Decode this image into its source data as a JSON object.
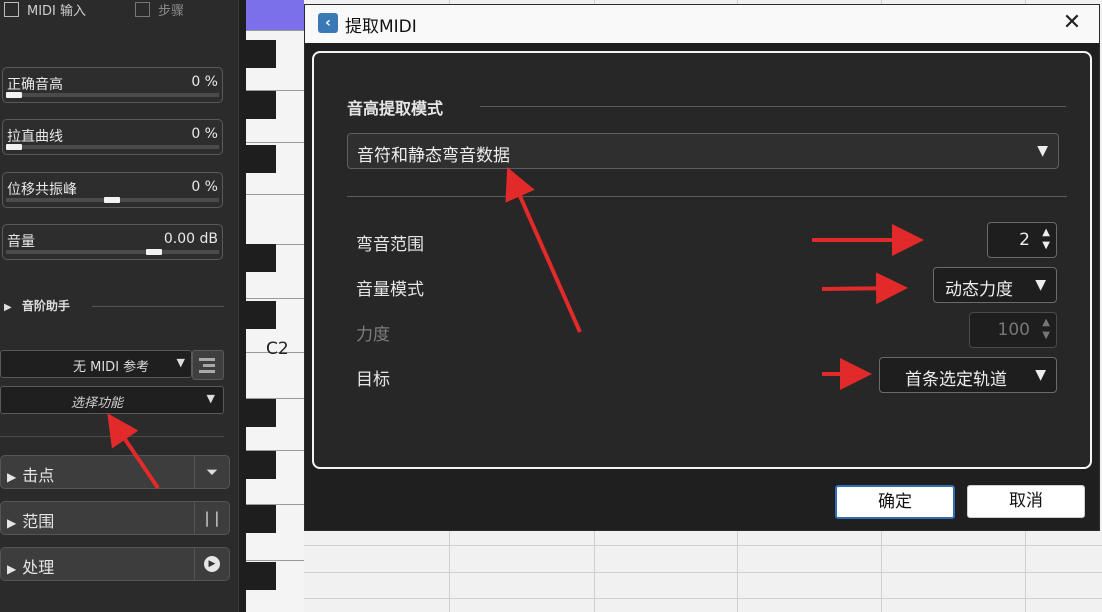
{
  "inspector": {
    "midi_input_label": "MIDI 输入",
    "step_label": "步骤",
    "sliders": [
      {
        "name": "正确音高",
        "value": "0 %",
        "level": 0.0
      },
      {
        "name": "拉直曲线",
        "value": "0 %",
        "level": 0.0
      },
      {
        "name": "位移共振峰",
        "value": "0 %",
        "level": 0.5
      },
      {
        "name": "音量",
        "value": "0.00 dB",
        "level": 0.72
      }
    ],
    "scale_assistant": "音阶助手",
    "midi_reference": "无 MIDI 参考",
    "select_function": "选择功能",
    "panels": [
      {
        "label": "击点",
        "icon": "filter-icon"
      },
      {
        "label": "范围",
        "icon": "range-icon"
      },
      {
        "label": "处理",
        "icon": "play-circle-icon"
      }
    ]
  },
  "keyboard": {
    "note_label": "C2"
  },
  "dialog": {
    "title": "提取MIDI",
    "group_title": "音高提取模式",
    "mode_value": "音符和静态弯音数据",
    "rows": {
      "bend_range": {
        "label": "弯音范围",
        "value": "2"
      },
      "volume_mode": {
        "label": "音量模式",
        "value": "动态力度"
      },
      "velocity": {
        "label": "力度",
        "value": "100"
      },
      "target": {
        "label": "目标",
        "value": "首条选定轨道"
      }
    },
    "ok": "确定",
    "cancel": "取消",
    "close_glyph": "✕"
  },
  "glyphs": {
    "triangle_right": "▶",
    "triangle_down": "▼",
    "spin": "▲▼"
  },
  "colors": {
    "accent": "#2f6db5",
    "arrow": "#e32a2a",
    "ruler_purple": "#7c70e8"
  }
}
